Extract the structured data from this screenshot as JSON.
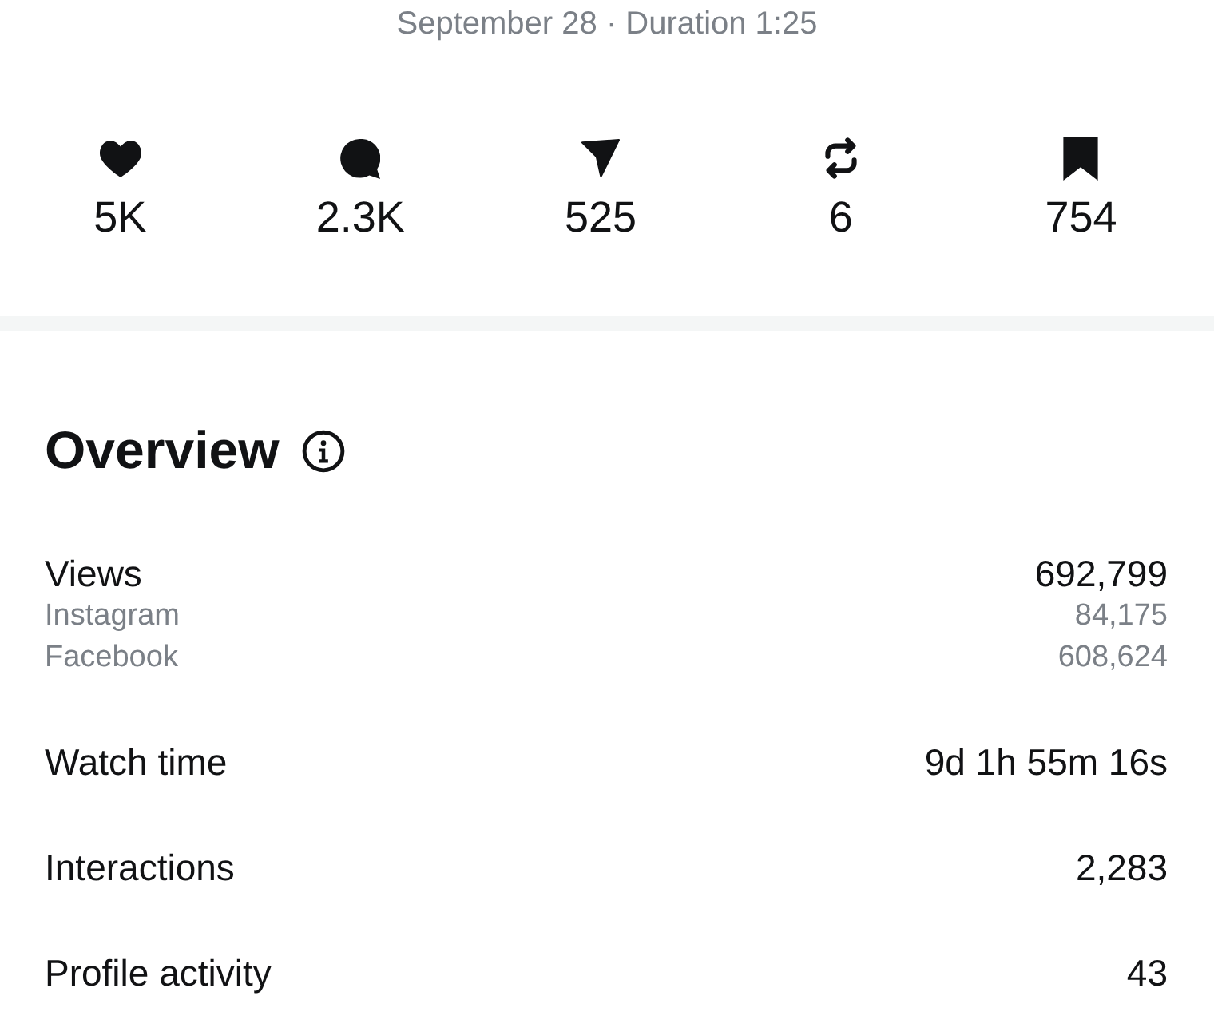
{
  "header": {
    "subtitle": "September 28 · Duration 1:25"
  },
  "stats": [
    {
      "kind": "likes",
      "value": "5K"
    },
    {
      "kind": "comments",
      "value": "2.3K"
    },
    {
      "kind": "shares",
      "value": "525"
    },
    {
      "kind": "reposts",
      "value": "6"
    },
    {
      "kind": "saves",
      "value": "754"
    }
  ],
  "overview": {
    "title": "Overview",
    "metrics": [
      {
        "label": "Views",
        "value": "692,799",
        "breakdown": [
          {
            "label": "Instagram",
            "value": "84,175"
          },
          {
            "label": "Facebook",
            "value": "608,624"
          }
        ]
      },
      {
        "label": "Watch time",
        "value": "9d 1h 55m 16s"
      },
      {
        "label": "Interactions",
        "value": "2,283"
      },
      {
        "label": "Profile activity",
        "value": "43"
      }
    ]
  }
}
